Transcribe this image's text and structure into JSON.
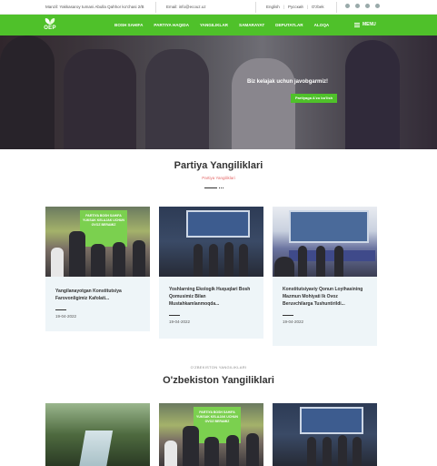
{
  "topbar": {
    "address": "Manzil: Yakkasaroy tumani Abulla Qahhor ko'chasi 2/B",
    "email": "Email: info@ecouz.uz",
    "languages": [
      "English",
      "Русский",
      "O'zbek"
    ],
    "socials": [
      "facebook-icon",
      "telegram-icon",
      "youtube-icon",
      "instagram-icon"
    ]
  },
  "nav": {
    "logo_text": "OEP",
    "items": [
      "BOSH SAHIFA",
      "PARTIYA HAQIDA",
      "YANGILIKLAR",
      "SAMARAYAT",
      "DEPUTATLAR",
      "ALOQA"
    ],
    "menu_label": "MENU"
  },
  "hero": {
    "slogan": "Biz kelajak uchun javobgarmiz!",
    "cta": "Partiyaga A'zo bo'lish"
  },
  "section1": {
    "title": "Partiya Yangiliklari",
    "subtitle": "Partiya Yangiliklari",
    "cards": [
      {
        "title": "Yangilanayotgan Konstitutsiya Farovonligimiz Kafolati...",
        "date": "19-04-2022"
      },
      {
        "title": "Yoshlarning Ekologik Huquqlari Bosh Qomusimiz Bilan Mustahkamlanmoqda...",
        "date": "19-04-2022",
        "banner": "PARTIYA BOSH SAHIFA YUKSAK KELAJAK UCHUN OVOZ BERAMIZ"
      },
      {
        "title": "Konstitutsiyaviy Qonun Loyihasining Mazmun Mohiyati Ik Ovoz Beruvchilarga Tushuntirildi...",
        "date": "19-04-2022"
      }
    ],
    "card1_banner": "PARTIYA BOSH SAHIFA YUKSAK KELAJAK UCHUN OVOZ BERAMIZ"
  },
  "section2": {
    "subtitle": "O'ZBEKISTON YANGILIKLARI",
    "title": "O'zbekiston Yangiliklari",
    "card2_banner": "PARTIYA BOSH SAHIFA YUKSAK KELAJAK UCHUN OVOZ BERAMIZ"
  }
}
